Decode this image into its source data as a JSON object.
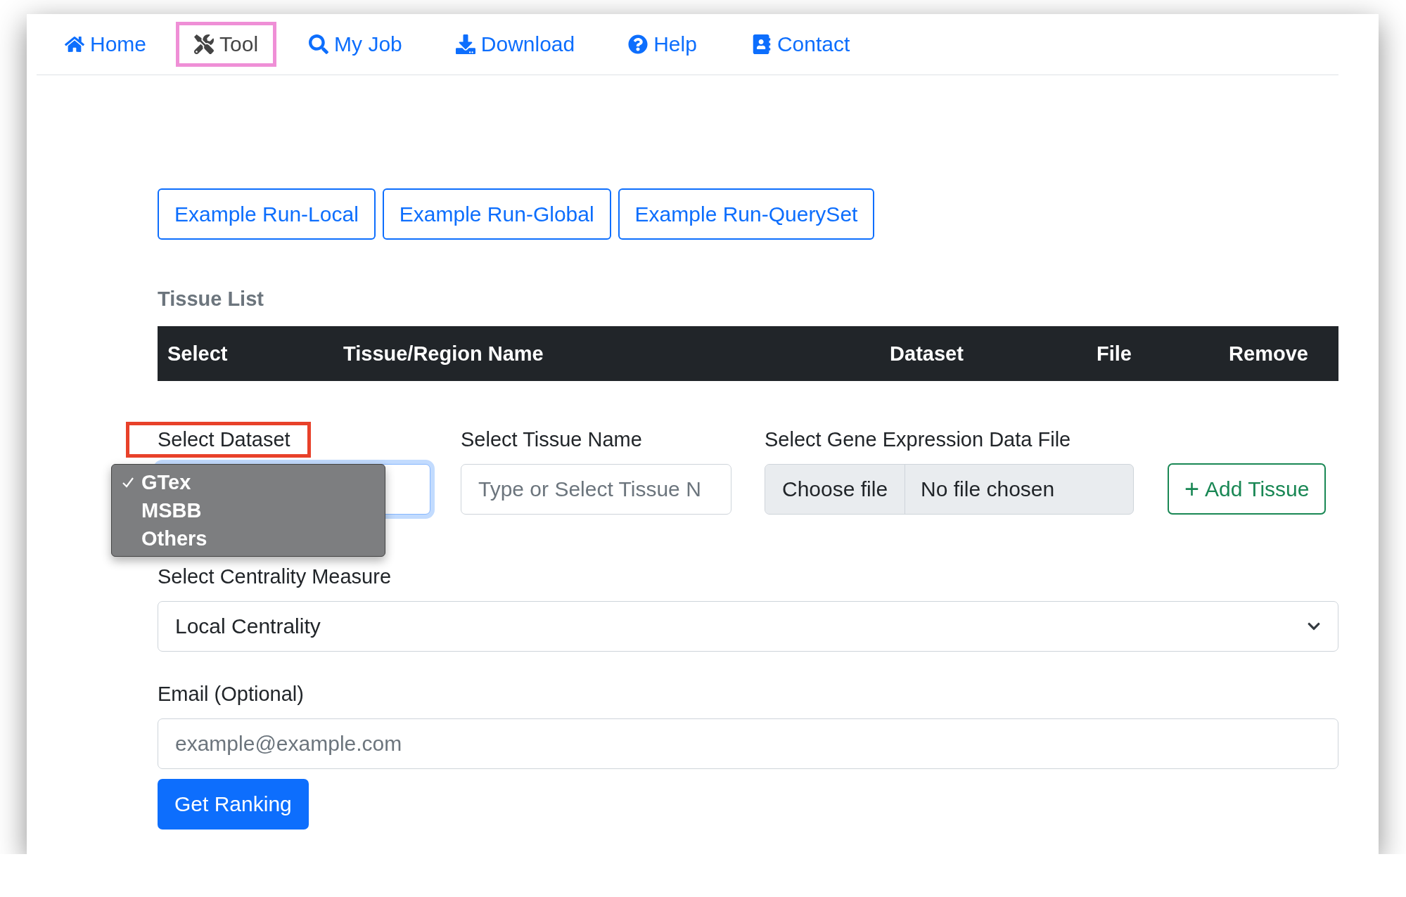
{
  "nav": [
    {
      "label": "Home",
      "selected": false,
      "highlighted": false
    },
    {
      "label": "Tool",
      "selected": true,
      "highlighted": true
    },
    {
      "label": "My Job",
      "selected": false,
      "highlighted": false
    },
    {
      "label": "Download",
      "selected": false,
      "highlighted": false
    },
    {
      "label": "Help",
      "selected": false,
      "highlighted": false
    },
    {
      "label": "Contact",
      "selected": false,
      "highlighted": false
    }
  ],
  "example_buttons": [
    "Example Run-Local",
    "Example Run-Global",
    "Example Run-QuerySet"
  ],
  "tissue_list": {
    "title": "Tissue List",
    "columns": [
      "Select",
      "Tissue/Region Name",
      "Dataset",
      "File",
      "Remove"
    ]
  },
  "dataset": {
    "label": "Select Dataset",
    "highlighted": true,
    "open": true,
    "options": [
      {
        "label": "GTex",
        "selected": true
      },
      {
        "label": "MSBB",
        "selected": false
      },
      {
        "label": "Others",
        "selected": false
      }
    ]
  },
  "tissue": {
    "label": "Select Tissue Name",
    "placeholder": "Type or Select Tissue N"
  },
  "file": {
    "label": "Select Gene Expression Data File",
    "button": "Choose file",
    "status": "No file chosen"
  },
  "add_button": {
    "icon": "+",
    "label": "Add Tissue"
  },
  "centrality": {
    "label": "Select Centrality Measure",
    "value": "Local Centrality"
  },
  "email": {
    "label": "Email (Optional)",
    "placeholder": "example@example.com"
  },
  "submit": "Get Ranking"
}
